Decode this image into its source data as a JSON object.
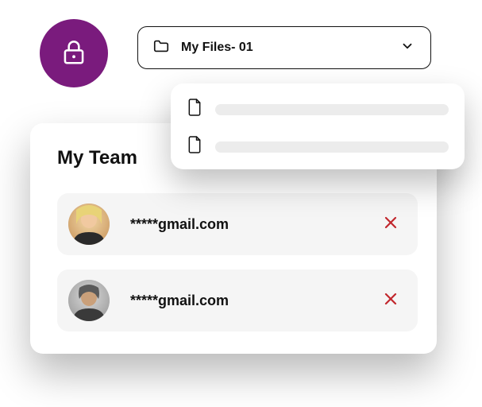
{
  "colors": {
    "lock_badge_bg": "#7a1b7d",
    "remove_icon": "#c1272d"
  },
  "folder_select": {
    "label": "My Files- 01"
  },
  "files_popover": {
    "items": [
      {
        "name_placeholder": true
      },
      {
        "name_placeholder": true
      }
    ]
  },
  "team_card": {
    "title": "My Team",
    "members": [
      {
        "email_masked": "*****gmail.com"
      },
      {
        "email_masked": "*****gmail.com"
      }
    ]
  }
}
